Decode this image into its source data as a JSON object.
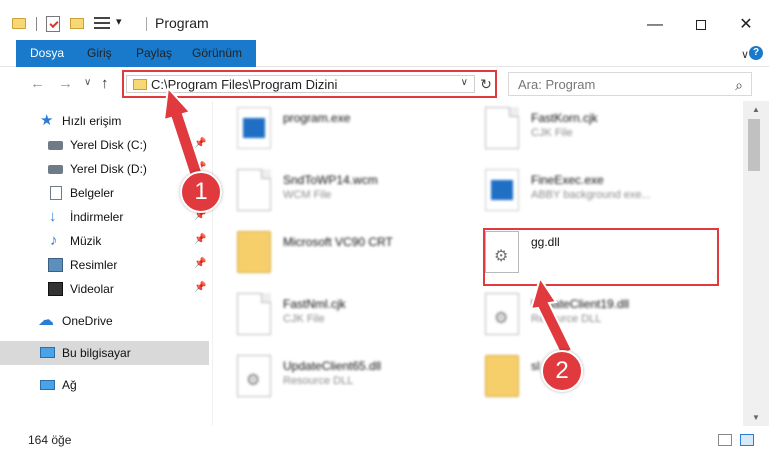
{
  "window": {
    "title": "Program",
    "quick_access_dropdown": "▾",
    "controls": {
      "minimize": "—",
      "maximize": "",
      "close": "✕"
    }
  },
  "ribbon": {
    "tabs": [
      {
        "label": "Dosya"
      },
      {
        "label": "Giriş"
      },
      {
        "label": "Paylaş"
      },
      {
        "label": "Görünüm"
      }
    ],
    "expand": "∨",
    "help": "?"
  },
  "navigation": {
    "back": "←",
    "forward": "→",
    "recent": "∨",
    "up": "↑",
    "address": "C:\\Program Files\\Program Dizini",
    "address_dropdown": "∨",
    "refresh": "↻",
    "search_placeholder": "Ara: Program",
    "search_icon": "⌕"
  },
  "sidebar": {
    "items": [
      {
        "label": "Hızlı erişim",
        "icon": "star-icon",
        "pinned": false
      },
      {
        "label": "Yerel Disk (C:)",
        "icon": "drive-icon",
        "pinned": true
      },
      {
        "label": "Yerel Disk (D:)",
        "icon": "drive-icon",
        "pinned": true
      },
      {
        "label": "Belgeler",
        "icon": "document-icon",
        "pinned": true
      },
      {
        "label": "İndirmeler",
        "icon": "download-icon",
        "pinned": true
      },
      {
        "label": "Müzik",
        "icon": "music-icon",
        "pinned": true
      },
      {
        "label": "Resimler",
        "icon": "pictures-icon",
        "pinned": true
      },
      {
        "label": "Videolar",
        "icon": "video-icon",
        "pinned": true
      },
      {
        "label": "OneDrive",
        "icon": "cloud-icon",
        "pinned": false
      },
      {
        "label": "Bu bilgisayar",
        "icon": "computer-icon",
        "pinned": false,
        "selected": true
      },
      {
        "label": "Ağ",
        "icon": "network-icon",
        "pinned": false
      }
    ],
    "pin_glyph": "📌"
  },
  "files": [
    {
      "name": "program.exe",
      "type": "",
      "icon": "program-icon"
    },
    {
      "name": "FastKorn.cjk",
      "type": "CJK File",
      "icon": "file-icon"
    },
    {
      "name": "SndToWP14.wcm",
      "type": "WCM File",
      "icon": "file-icon"
    },
    {
      "name": "FineExec.exe",
      "type": "ABBY background exe...",
      "icon": "exe-icon"
    },
    {
      "name": "Microsoft VC90 CRT",
      "type": "",
      "icon": "folder-icon"
    },
    {
      "name": "gg.dll",
      "type": "",
      "icon": "dll-gear-icon"
    },
    {
      "name": "FastNml.cjk",
      "type": "CJK File",
      "icon": "file-icon"
    },
    {
      "name": "UpdateClient19.dll",
      "type": "Resource DLL",
      "icon": "dll-gear-icon"
    },
    {
      "name": "UpdateClient65.dll",
      "type": "Resource DLL",
      "icon": "dll-gear-icon"
    },
    {
      "name": "sl",
      "type": "",
      "icon": "folder-icon"
    }
  ],
  "status": {
    "item_count": "164 öğe"
  },
  "annotations": {
    "step1": "1",
    "step2": "2",
    "color": "#e0393e"
  },
  "colors": {
    "accent": "#1979ca",
    "highlight": "#e0393e",
    "selected_bg": "#d9d9d9"
  }
}
